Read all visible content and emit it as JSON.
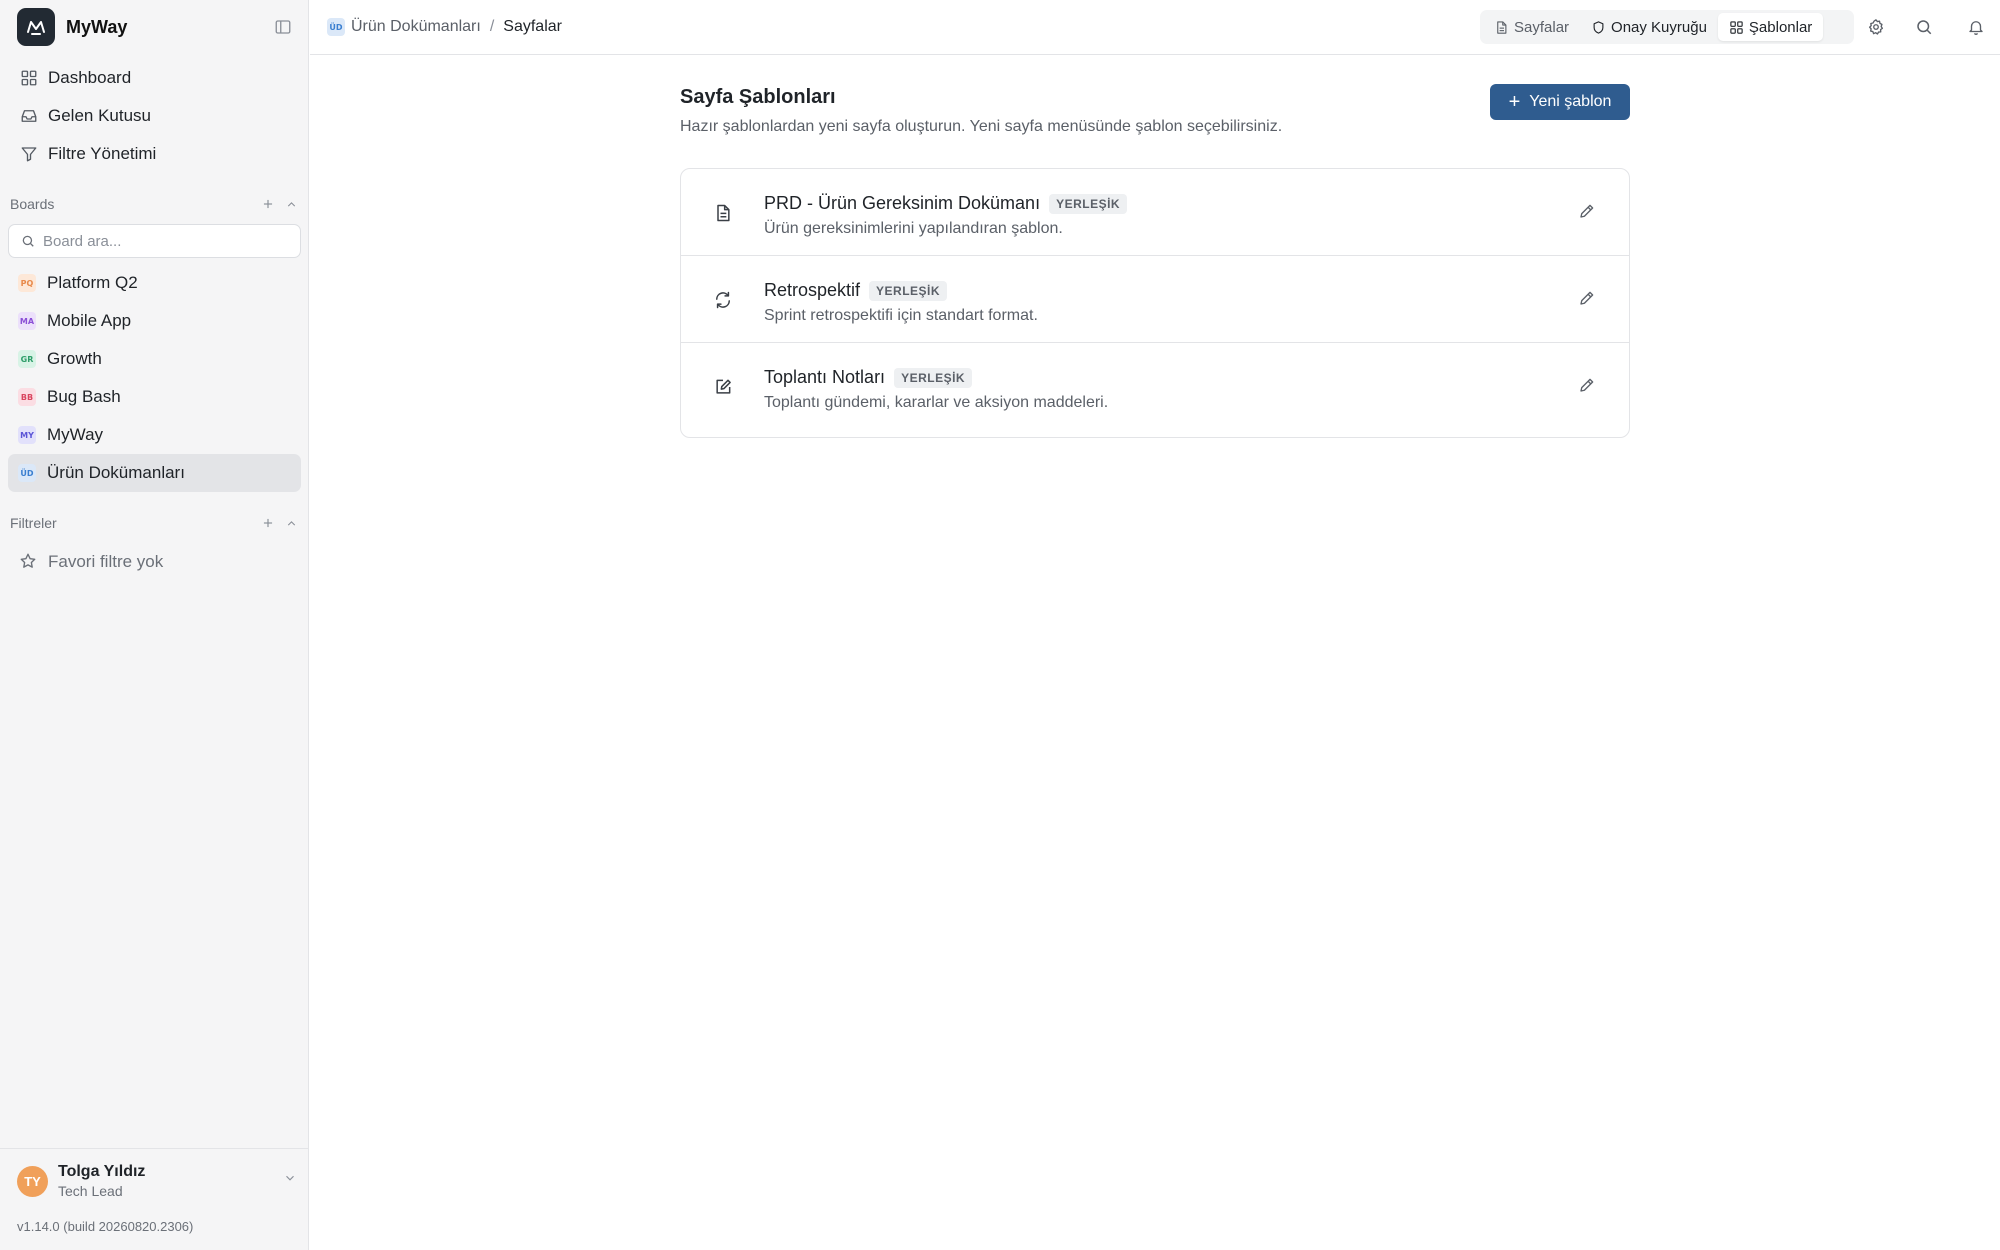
{
  "app": {
    "name": "MyWay"
  },
  "sidebar": {
    "nav": [
      {
        "label": "Dashboard",
        "icon": "grid-icon"
      },
      {
        "label": "Gelen Kutusu",
        "icon": "inbox-icon"
      },
      {
        "label": "Filtre Yönetimi",
        "icon": "filter-icon"
      }
    ],
    "boards_section": {
      "title": "Boards",
      "search_placeholder": "Board ara..."
    },
    "boards": [
      {
        "abbr": "PQ",
        "label": "Platform Q2",
        "color": "#e8894a",
        "bg": "#fde8d8"
      },
      {
        "abbr": "MA",
        "label": "Mobile App",
        "color": "#8b4fd6",
        "bg": "#ece0fb"
      },
      {
        "abbr": "GR",
        "label": "Growth",
        "color": "#2f9e6a",
        "bg": "#d8f3e6"
      },
      {
        "abbr": "BB",
        "label": "Bug Bash",
        "color": "#d9455f",
        "bg": "#fbdde3"
      },
      {
        "abbr": "MY",
        "label": "MyWay",
        "color": "#5b55d6",
        "bg": "#e2e1fb"
      },
      {
        "abbr": "ÜD",
        "label": "Ürün Dokümanları",
        "color": "#3b7fd0",
        "bg": "#dbe8f8",
        "active": true
      }
    ],
    "filters_section": {
      "title": "Filtreler",
      "empty_label": "Favori filtre yok"
    },
    "user": {
      "initials": "TY",
      "name": "Tolga Yıldız",
      "role": "Tech Lead"
    },
    "version": "v1.14.0 (build 20260820.2306)"
  },
  "topbar": {
    "breadcrumb": {
      "badge": "ÜD",
      "parent": "Ürün Dokümanları",
      "separator": "/",
      "current": "Sayfalar"
    },
    "tabs": [
      {
        "label": "Sayfalar",
        "icon": "file-icon"
      },
      {
        "label": "Onay Kuyruğu",
        "icon": "shield-icon"
      },
      {
        "label": "Şablonlar",
        "icon": "grid-icon",
        "active": true
      }
    ]
  },
  "main": {
    "title": "Sayfa Şablonları",
    "subtitle": "Hazır şablonlardan yeni sayfa oluşturun. Yeni sayfa menüsünde şablon seçebilirsiniz.",
    "new_button": "Yeni şablon",
    "templates": [
      {
        "title": "PRD - Ürün Gereksinim Dokümanı",
        "tag": "YERLEŞİK",
        "description": "Ürün gereksinimlerini yapılandıran şablon.",
        "icon": "document-icon"
      },
      {
        "title": "Retrospektif",
        "tag": "YERLEŞİK",
        "description": "Sprint retrospektifi için standart format.",
        "icon": "refresh-icon"
      },
      {
        "title": "Toplantı Notları",
        "tag": "YERLEŞİK",
        "description": "Toplantı gündemi, kararlar ve aksiyon maddeleri.",
        "icon": "edit-square-icon"
      }
    ]
  },
  "colors": {
    "accent": "#2f5c8f",
    "sidebar_bg": "#f5f5f6",
    "active_item": "#e3e4e7"
  }
}
